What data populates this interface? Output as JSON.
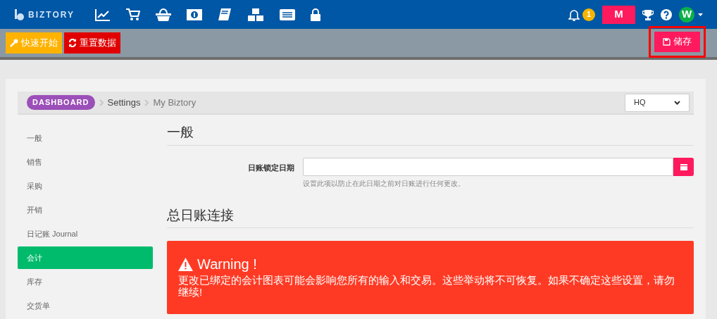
{
  "brand": {
    "name": "BIZTORY"
  },
  "nav_icons": [
    {
      "kind": "chart"
    },
    {
      "kind": "cart"
    },
    {
      "kind": "basket"
    },
    {
      "kind": "money"
    },
    {
      "kind": "book"
    },
    {
      "kind": "cubes"
    },
    {
      "kind": "list"
    },
    {
      "kind": "lock"
    }
  ],
  "notifications": {
    "count": "1"
  },
  "user_button": "M",
  "avatar": "W",
  "toolbar": {
    "buttons": [
      {
        "label": "快速开始",
        "kind": "wrench"
      },
      {
        "label": "重置数据",
        "kind": "refresh"
      }
    ],
    "save": {
      "label": "储存",
      "highlighted": true
    }
  },
  "breadcrumb": [
    {
      "label": "DASHBOARD",
      "kind": "pill"
    },
    {
      "label": "Settings",
      "kind": "link"
    },
    {
      "label": "My Biztory",
      "kind": "current"
    }
  ],
  "branch_select": {
    "value": "HQ"
  },
  "sidebar": {
    "items": [
      {
        "label": "一般",
        "selected": false
      },
      {
        "label": "销售",
        "selected": false
      },
      {
        "label": "采购",
        "selected": false
      },
      {
        "label": "开销",
        "selected": false
      },
      {
        "label": "日记账 Journal",
        "selected": false
      },
      {
        "label": "会计",
        "selected": true
      },
      {
        "label": "库存",
        "selected": false
      },
      {
        "label": "交货单",
        "selected": false
      }
    ]
  },
  "sections": [
    {
      "title": "一般",
      "fields": [
        {
          "label": "日账锁定日期",
          "help": "设置此项以防止在此日期之前对日账进行任何更改。"
        }
      ]
    },
    {
      "title": "总日账连接"
    }
  ],
  "warning": {
    "title": "Warning !",
    "message": "更改已绑定的会计图表可能会影响您所有的输入和交易。这些举动将不可恢复。如果不确定这些设置，请勿继续!"
  }
}
